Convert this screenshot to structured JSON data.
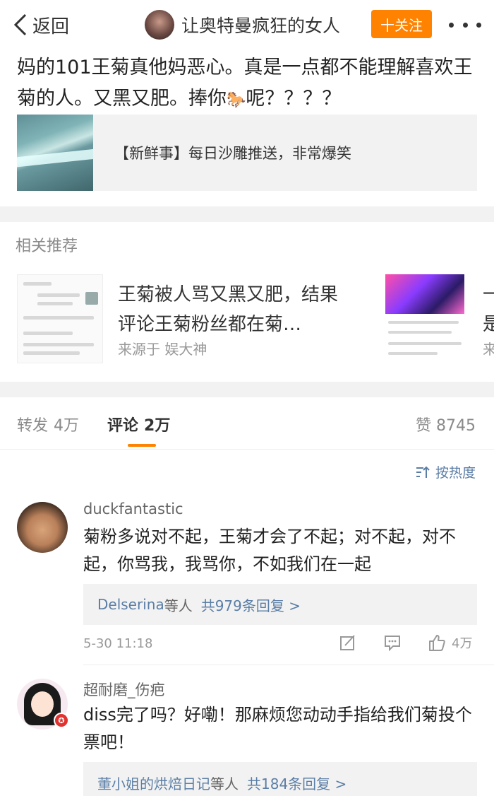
{
  "header": {
    "back_label": "返回",
    "title": "让奥特曼疯狂的女人",
    "follow_label": "十关注"
  },
  "post": {
    "text_before_emoji": "妈的101王菊真他妈恶心。真是一点都不能理解喜欢王菊的人。又黑又肥。捧你",
    "emoji": "🐎",
    "text_after_emoji": "呢？？？？",
    "link_card_title": "【新鲜事】每日沙雕推送，非常爆笑"
  },
  "related": {
    "heading": "相关推荐",
    "items": [
      {
        "title": "王菊被人骂又黑又肥，结果评论王菊粉丝都在菊…",
        "source": "来源于 娱大神"
      },
      {
        "title_line1_cut": "一",
        "title_line2_cut": "是",
        "source_cut": "来"
      }
    ]
  },
  "tabs": {
    "repost_label": "转发",
    "repost_count": "4万",
    "comment_label": "评论",
    "comment_count": "2万",
    "like_label": "赞",
    "like_count": "8745"
  },
  "sort_label": "按热度",
  "comments": [
    {
      "username": "duckfantastic",
      "text": "菊粉多说对不起，王菊才会了不起；对不起，对不起，你骂我，我骂你，不如我们在一起",
      "reply_who": "Delserina",
      "reply_mid": "等人",
      "reply_count": "共979条回复 >",
      "time": "5-30 11:18",
      "likes": "4万"
    },
    {
      "username": "超耐磨_伤疤",
      "badge": "✪",
      "text": "diss完了吗？好嘞！那麻烦您动动手指给我们菊投个票吧！",
      "reply_who": "董小姐的烘焙日记",
      "reply_mid": "等人",
      "reply_count": "共184条回复 >"
    }
  ],
  "colors": {
    "accent": "#ff8200",
    "link": "#5b7ea6",
    "muted": "#999999",
    "badge": "#e0322f"
  }
}
